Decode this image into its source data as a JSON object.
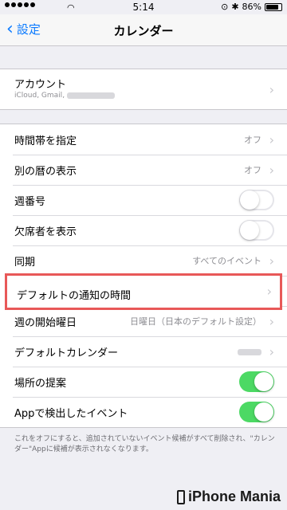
{
  "status_bar": {
    "wifi": "wifi",
    "time": "5:14",
    "battery": "86%",
    "battery_level": 0.86,
    "indicators": [
      "lock-rotation-icon",
      "bluetooth-icon"
    ]
  },
  "nav": {
    "back_label": "設定",
    "title": "カレンダー"
  },
  "account": {
    "label": "アカウント",
    "sub": "iCloud, Gmail,"
  },
  "settings": [
    {
      "label": "時間帯を指定",
      "value": "オフ",
      "type": "disclosure"
    },
    {
      "label": "別の暦の表示",
      "value": "オフ",
      "type": "disclosure"
    },
    {
      "label": "週番号",
      "type": "toggle",
      "on": false
    },
    {
      "label": "欠席者を表示",
      "type": "toggle",
      "on": false
    },
    {
      "label": "同期",
      "value": "すべてのイベント",
      "type": "disclosure"
    },
    {
      "label": "デフォルトの通知の時間",
      "type": "disclosure"
    },
    {
      "label": "週の開始曜日",
      "value": "日曜日（日本のデフォルト設定）",
      "type": "disclosure"
    },
    {
      "label": "デフォルトカレンダー",
      "type": "disclosure"
    },
    {
      "label": "場所の提案",
      "type": "toggle",
      "on": true
    },
    {
      "label": "Appで検出したイベント",
      "type": "toggle",
      "on": true
    }
  ],
  "footnote": "これをオフにすると、追加されていないイベント候補がすべて削除され、\"カレンダー\"Appに候補が表示されなくなります。",
  "brand": "iPhone Mania",
  "colors": {
    "accent": "#0a7aff",
    "toggle_on": "#4cd964",
    "highlight": "#e85858"
  }
}
